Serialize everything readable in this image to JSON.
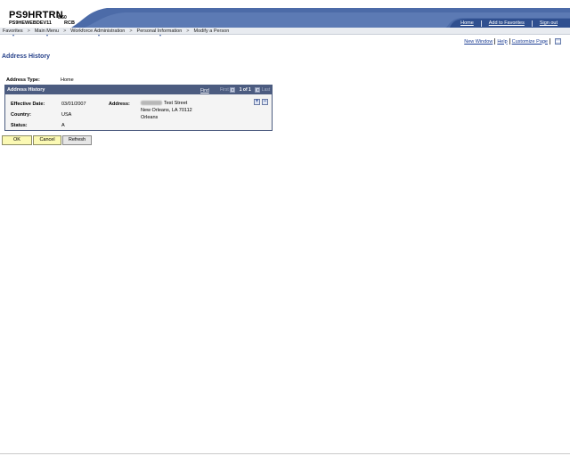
{
  "header": {
    "app_name": "PS9HRTRN",
    "version": "8.50",
    "database": "PS9HEWEBDEV11",
    "user": "RCB",
    "links": [
      {
        "name": "link-home",
        "label": "Home"
      },
      {
        "name": "link-add-to-favorites",
        "label": "Add to Favorites"
      },
      {
        "name": "link-sign-out",
        "label": "Sign out"
      }
    ]
  },
  "breadcrumb": {
    "items": [
      "Favorites",
      "Main Menu",
      "Workforce Administration",
      "Personal Information",
      "Modify a Person"
    ],
    "separator": ">"
  },
  "page_tools": {
    "new_window": "New Window",
    "help": "Help",
    "customize_page": "Customize Page"
  },
  "page": {
    "title": "Address History",
    "address_type_label": "Address Type:",
    "address_type_value": "Home"
  },
  "grid": {
    "title": "Address History",
    "find": "Find",
    "first": "First",
    "count": "1 of 1",
    "last": "Last",
    "add_row": "+",
    "delete_row": "−",
    "fields": {
      "effective_date_label": "Effective Date:",
      "effective_date_value": "03/01/2007",
      "country_label": "Country:",
      "country_value": "USA",
      "status_label": "Status:",
      "status_value": "A",
      "address_label": "Address:",
      "address_line1": "Test Street",
      "address_line2": "New Orleans, LA 70112",
      "address_line3": "Orleans"
    }
  },
  "buttons": {
    "ok": "OK",
    "cancel": "Cancel",
    "refresh": "Refresh"
  },
  "colors": {
    "header_blue": "#4c6ba8",
    "grid_header": "#4c5c80",
    "link": "#1d3e94",
    "title": "#26418a",
    "button_yellow": "#fbf9b4"
  }
}
